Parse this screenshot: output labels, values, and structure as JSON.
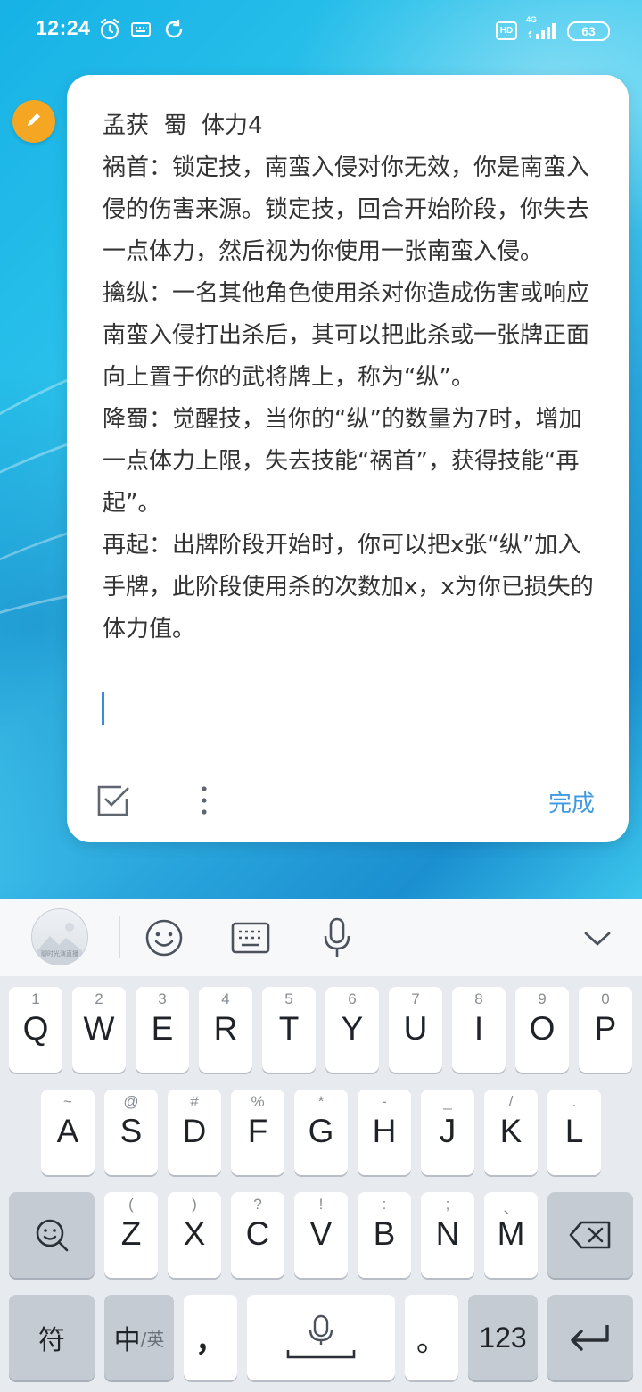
{
  "status_bar": {
    "time": "12:24",
    "hd": "HD",
    "network": "4G",
    "battery": "63",
    "icons": [
      "alarm-icon",
      "keyboard-status-icon",
      "sync-icon",
      "signal-icon"
    ]
  },
  "note": {
    "paragraphs": [
      "孟获  蜀  体力4",
      "祸首：锁定技，南蛮入侵对你无效，你是南蛮入侵的伤害来源。锁定技，回合开始阶段，你失去一点体力，然后视为你使用一张南蛮入侵。",
      "擒纵：一名其他角色使用杀对你造成伤害或响应南蛮入侵打出杀后，其可以把此杀或一张牌正面向上置于你的武将牌上，称为“纵”。",
      "降蜀：觉醒技，当你的“纵”的数量为7时，增加一点体力上限，失去技能“祸首”，获得技能“再起”。",
      "再起：出牌阶段开始时，你可以把x张“纵”加入手牌，此阶段使用杀的次数加x，x为你已损失的体力值。"
    ],
    "done_label": "完成",
    "icons": [
      "edit-pencil-icon",
      "checklist-icon",
      "more-vertical-icon"
    ]
  },
  "keyboard": {
    "toolbar": {
      "avatar_caption": "聊时光演直播",
      "icons": [
        "emoji-icon",
        "keyboard-icon",
        "microphone-icon",
        "chevron-down-icon"
      ]
    },
    "row1": [
      {
        "hint": "1",
        "key": "Q"
      },
      {
        "hint": "2",
        "key": "W"
      },
      {
        "hint": "3",
        "key": "E"
      },
      {
        "hint": "4",
        "key": "R"
      },
      {
        "hint": "5",
        "key": "T"
      },
      {
        "hint": "6",
        "key": "Y"
      },
      {
        "hint": "7",
        "key": "U"
      },
      {
        "hint": "8",
        "key": "I"
      },
      {
        "hint": "9",
        "key": "O"
      },
      {
        "hint": "0",
        "key": "P"
      }
    ],
    "row2": [
      {
        "hint": "~",
        "key": "A"
      },
      {
        "hint": "@",
        "key": "S"
      },
      {
        "hint": "#",
        "key": "D"
      },
      {
        "hint": "%",
        "key": "F"
      },
      {
        "hint": "*",
        "key": "G"
      },
      {
        "hint": "-",
        "key": "H"
      },
      {
        "hint": "_",
        "key": "J"
      },
      {
        "hint": "/",
        "key": "K"
      },
      {
        "hint": ".",
        "key": "L"
      }
    ],
    "row3": [
      {
        "hint": "(",
        "key": "Z"
      },
      {
        "hint": ")",
        "key": "X"
      },
      {
        "hint": "?",
        "key": "C"
      },
      {
        "hint": "!",
        "key": "V"
      },
      {
        "hint": ":",
        "key": "B"
      },
      {
        "hint": ";",
        "key": "N"
      },
      {
        "hint": "、",
        "key": "M"
      }
    ],
    "bottom": {
      "symbols": "符",
      "lang_main": "中",
      "lang_sub": "/英",
      "comma": "，",
      "period": "。",
      "numbers": "123"
    }
  }
}
